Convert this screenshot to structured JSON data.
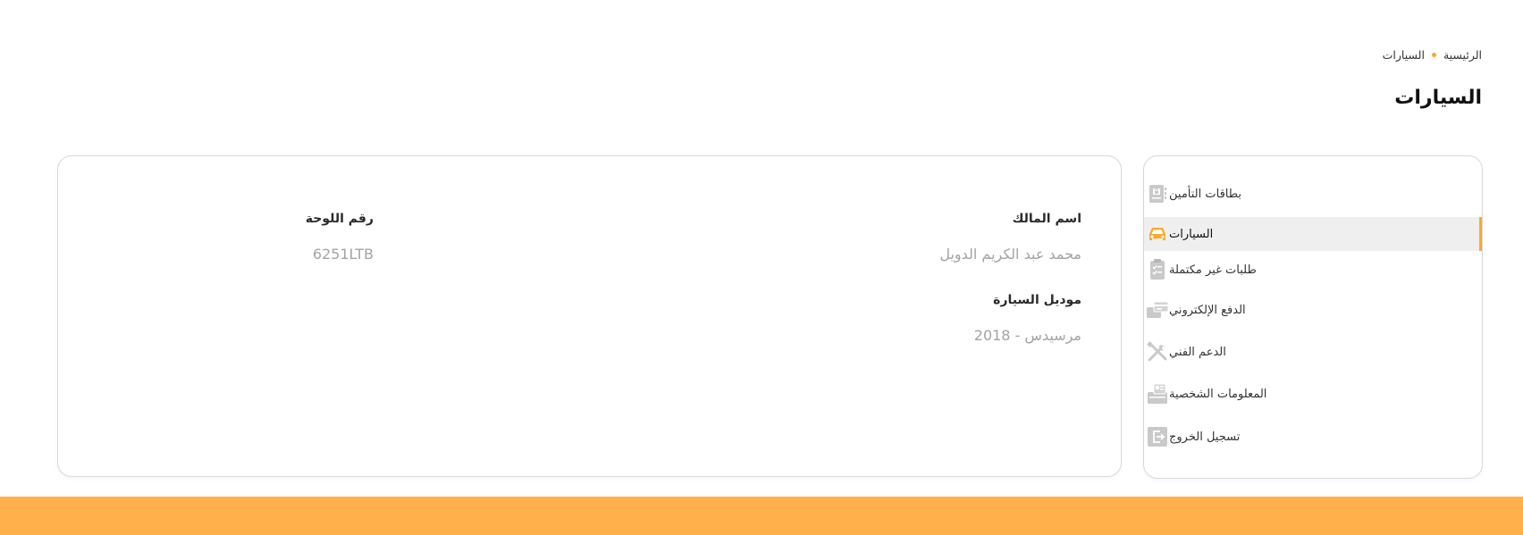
{
  "breadcrumb": {
    "home": "الرئيسية",
    "current": "السيارات"
  },
  "page": {
    "title": "السيارات"
  },
  "sidebar": {
    "items": [
      {
        "label": "بطاقات التأمين",
        "icon": "insurance-card-icon",
        "active": false
      },
      {
        "label": "السيارات",
        "icon": "car-icon",
        "active": true
      },
      {
        "label": "طلبات غير مكتملة",
        "icon": "clipboard-checklist-icon",
        "active": false
      },
      {
        "label": "الدفع الإلكتروني",
        "icon": "payment-card-icon",
        "active": false
      },
      {
        "label": "الدعم الفني",
        "icon": "tools-icon",
        "active": false
      },
      {
        "label": "المعلومات الشخصية",
        "icon": "id-card-icon",
        "active": false
      },
      {
        "label": "تسجيل الخروج",
        "icon": "logout-icon",
        "active": false
      }
    ]
  },
  "car": {
    "owner_label": "اسم المالك",
    "owner_value": "محمد عبد الكريم الدويل",
    "plate_label": "رقم اللوحة",
    "plate_value": "6251LTB",
    "model_label": "موديل السيارة",
    "model_value": "مرسيدس - 2018"
  },
  "colors": {
    "accent": "#FFA726",
    "footer": "#FFB04A",
    "icon_gray": "#c4c4c4",
    "active_bg": "#efefef"
  }
}
